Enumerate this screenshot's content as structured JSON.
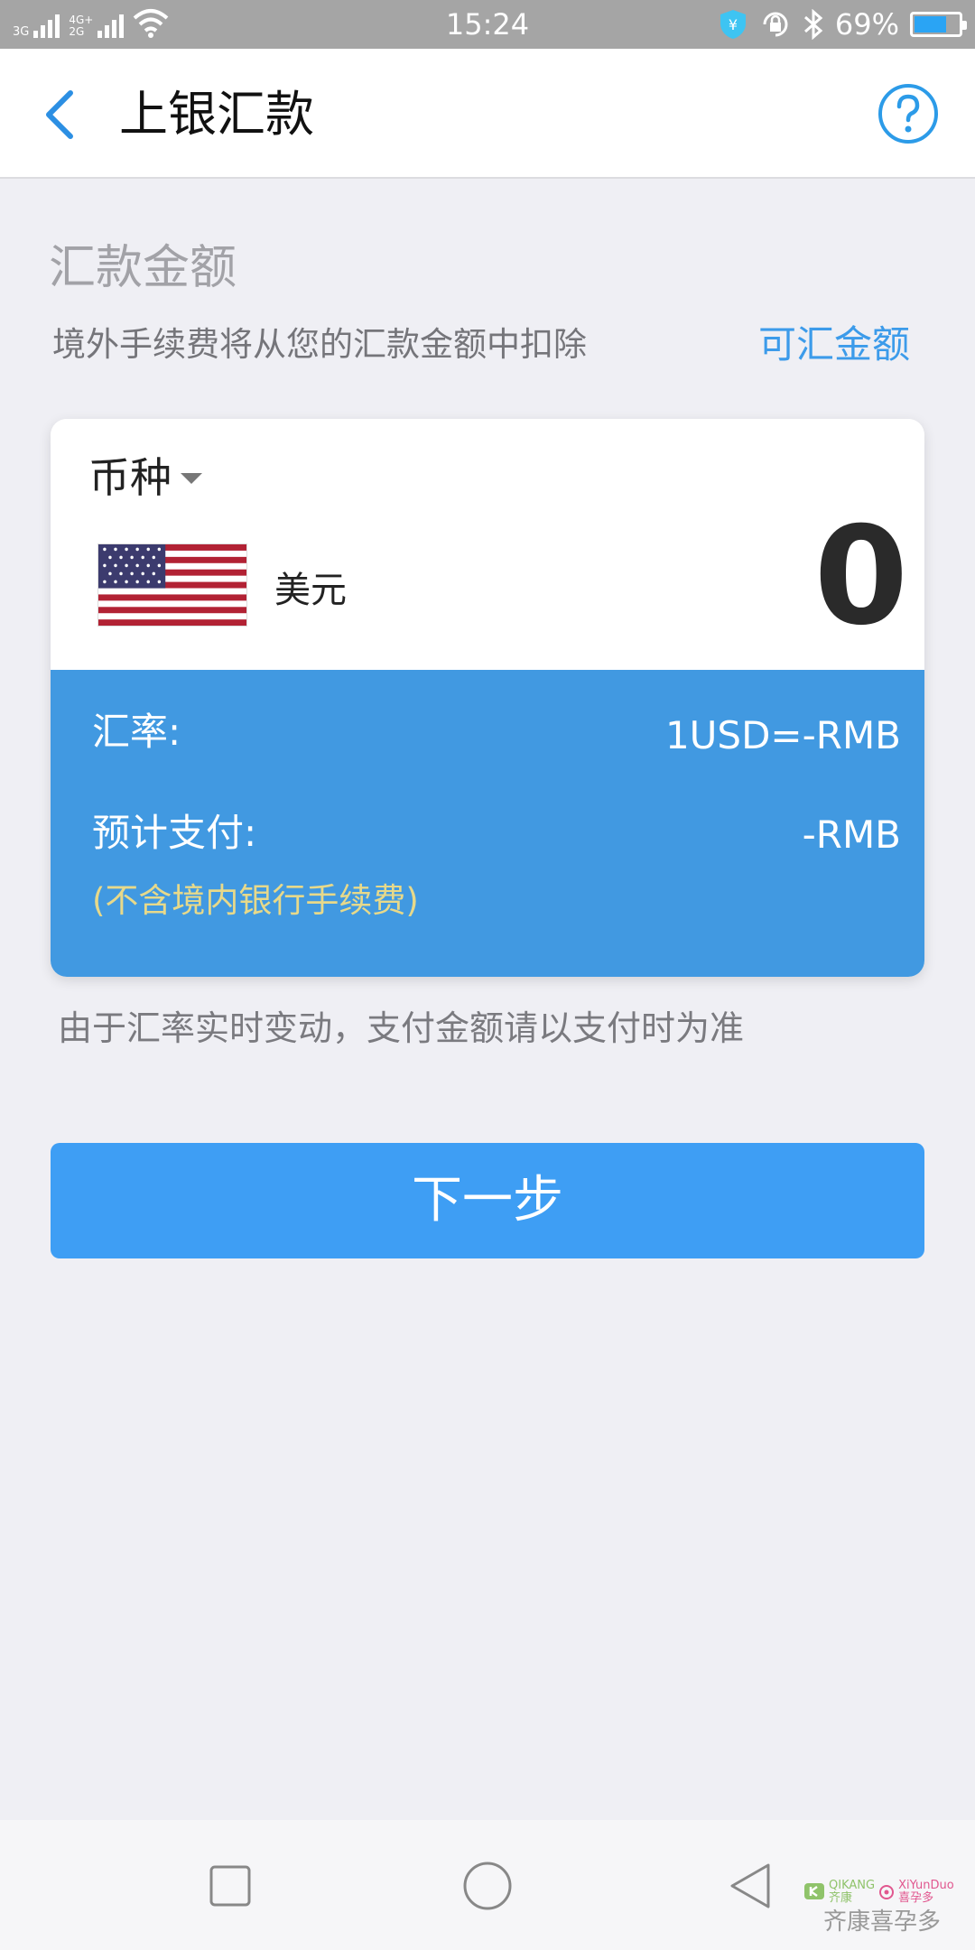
{
  "status_bar": {
    "sim1_label": "3G",
    "sim2_label_top": "4G+",
    "sim2_label_bottom": "2G",
    "time": "15:24",
    "battery_percent": "69%",
    "battery_level": 0.69,
    "icons": [
      "signal-icon",
      "wifi-icon",
      "shield-yen-icon",
      "lock-rotation-icon",
      "bluetooth-icon",
      "battery-icon"
    ]
  },
  "header": {
    "title": "上银汇款",
    "back_icon": "chevron-left-icon",
    "help_icon": "question-circle-icon"
  },
  "amount_section": {
    "title": "汇款金额",
    "fee_note": "境外手续费将从您的汇款金额中扣除",
    "available_link": "可汇金额"
  },
  "card": {
    "currency_label": "币种",
    "currency_name": "美元",
    "amount": "0",
    "rate_label": "汇率:",
    "rate_value": "1USD=-RMB",
    "pay_label": "预计支付:",
    "pay_value": "-RMB",
    "pay_note": "(不含境内银行手续费)"
  },
  "disclaimer": "由于汇率实时变动，支付金额请以支付时为准",
  "next_button": "下一步",
  "nav_bar": {
    "icons": [
      "square-recents-icon",
      "circle-home-icon",
      "triangle-back-icon"
    ]
  },
  "watermark": {
    "brand1": "QIKANG",
    "brand1_sub": "齐康",
    "brand2": "XiYunDuo",
    "brand2_sub": "喜孕多",
    "text": "齐康喜孕多"
  },
  "colors": {
    "accent": "#3e9ef4",
    "card_blue": "#4199e1",
    "link": "#3c9bea",
    "note_yellow": "#e7d98a"
  }
}
